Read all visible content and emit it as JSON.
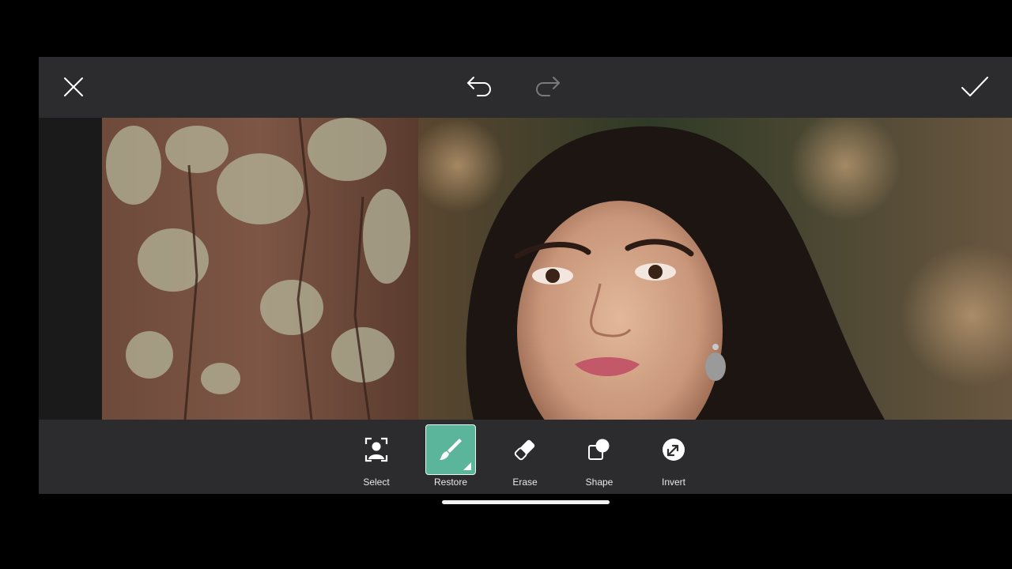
{
  "toolbar": {
    "close_icon": "close-icon",
    "undo_icon": "undo-icon",
    "redo_icon": "redo-icon",
    "apply_icon": "checkmark-icon"
  },
  "tools": [
    {
      "label": "Select",
      "icon": "person-select-icon",
      "active": false
    },
    {
      "label": "Restore",
      "icon": "brush-icon",
      "active": true
    },
    {
      "label": "Erase",
      "icon": "eraser-icon",
      "active": false
    },
    {
      "label": "Shape",
      "icon": "shape-icon",
      "active": false
    },
    {
      "label": "Invert",
      "icon": "invert-icon",
      "active": false
    }
  ],
  "colors": {
    "accent": "#5ab59a",
    "bar_background": "#2c2c2e",
    "text": "#e8e8e8"
  }
}
